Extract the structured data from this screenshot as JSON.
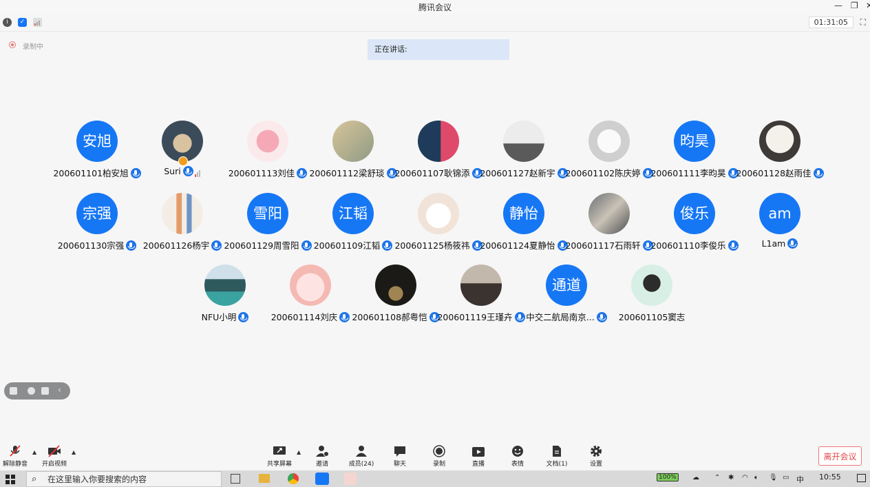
{
  "window": {
    "title": "腾讯会议"
  },
  "toolbar": {
    "timer": "01:31:05"
  },
  "recording": {
    "label": "录制中"
  },
  "speaking": {
    "label": "正在讲话:"
  },
  "participants": [
    {
      "name": "200601101柏安旭",
      "avatar_text": "安旭"
    },
    {
      "name": "Suri",
      "avatar_text": ""
    },
    {
      "name": "200601113刘佳",
      "avatar_text": ""
    },
    {
      "name": "200601112梁舒琰",
      "avatar_text": ""
    },
    {
      "name": "200601107耿锦添",
      "avatar_text": ""
    },
    {
      "name": "200601127赵新宇",
      "avatar_text": ""
    },
    {
      "name": "200601102陈庆婷",
      "avatar_text": ""
    },
    {
      "name": "200601111李昀昊",
      "avatar_text": "昀昊"
    },
    {
      "name": "200601128赵雨佳",
      "avatar_text": ""
    },
    {
      "name": "200601130宗强",
      "avatar_text": "宗强"
    },
    {
      "name": "200601126杨宇",
      "avatar_text": ""
    },
    {
      "name": "200601129周雪阳",
      "avatar_text": "雪阳"
    },
    {
      "name": "200601109江韬",
      "avatar_text": "江韬"
    },
    {
      "name": "200601125杨筱祎",
      "avatar_text": ""
    },
    {
      "name": "200601124夏静怡",
      "avatar_text": "静怡"
    },
    {
      "name": "200601117石雨轩",
      "avatar_text": ""
    },
    {
      "name": "200601110李俊乐",
      "avatar_text": "俊乐"
    },
    {
      "name": "L1am",
      "avatar_text": "am"
    },
    {
      "name": "NFU小明",
      "avatar_text": ""
    },
    {
      "name": "200601114刘庆",
      "avatar_text": ""
    },
    {
      "name": "200601108郝粤恺",
      "avatar_text": ""
    },
    {
      "name": "200601119王瑾卉",
      "avatar_text": ""
    },
    {
      "name": "中交二航局南京...",
      "avatar_text": "通道"
    },
    {
      "name": "200601105窦志",
      "avatar_text": ""
    }
  ],
  "bottom": {
    "unmute": "解除静音",
    "video": "开启视频",
    "share": "共享屏幕",
    "invite": "邀请",
    "members": "成员(24)",
    "chat": "聊天",
    "record": "录制",
    "live": "直播",
    "emoji": "表情",
    "docs": "文档(1)",
    "settings": "设置",
    "leave": "离开会议"
  },
  "taskbar": {
    "search_placeholder": "在这里输入你要搜索的内容",
    "battery": "100%",
    "ime": "中",
    "time": "10:55"
  },
  "colors": {
    "accent": "#1677f5",
    "leave": "#e34848"
  }
}
